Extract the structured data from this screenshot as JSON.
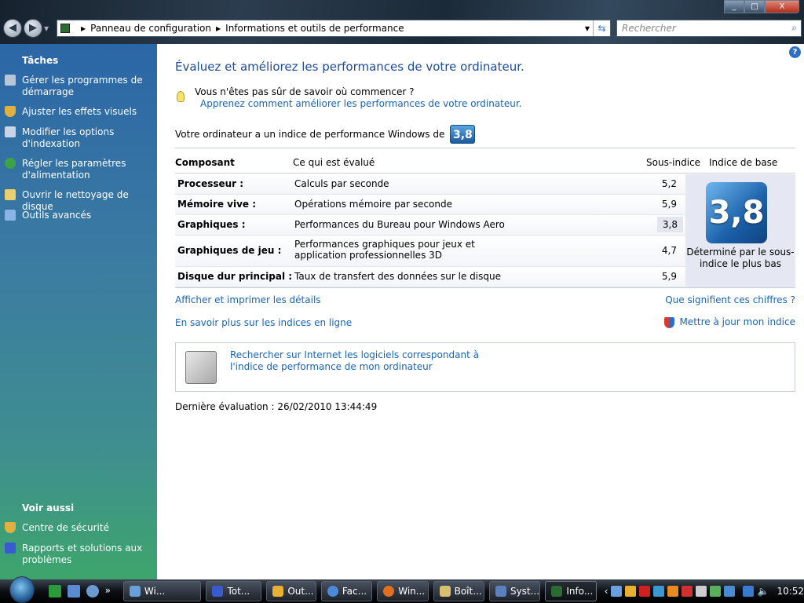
{
  "window": {
    "minimize": "_",
    "maximize": "□",
    "close": "X"
  },
  "nav": {
    "back": "◀",
    "forward": "▶"
  },
  "address": {
    "crumbs": [
      "Panneau de configuration",
      "Informations et outils de performance"
    ]
  },
  "search": {
    "placeholder": "Rechercher"
  },
  "sidebar": {
    "tasks_title": "Tâches",
    "tasks": [
      {
        "label": "Gérer les programmes de démarrage",
        "icon": "startup-programs-icon",
        "color": "#b9c6d8"
      },
      {
        "label": "Ajuster les effets visuels",
        "icon": "shield-icon",
        "color": "#e0b040"
      },
      {
        "label": "Modifier les options d'indexation",
        "icon": "indexing-icon",
        "color": "#c9d4e4"
      },
      {
        "label": "Régler les paramètres d'alimentation",
        "icon": "power-icon",
        "color": "#3aa34a"
      },
      {
        "label": "Ouvrir le nettoyage de disque",
        "icon": "disk-cleanup-icon",
        "color": "#e8d070"
      },
      {
        "label": "Outils avancés",
        "icon": "advanced-tools-icon",
        "color": "#8ab4e8"
      }
    ],
    "see_also_title": "Voir aussi",
    "see_also": [
      {
        "label": "Centre de sécurité",
        "icon": "security-center-icon",
        "color": "#e0b040"
      },
      {
        "label": "Rapports et solutions aux problèmes",
        "icon": "problem-reports-icon",
        "color": "#3a5ad0"
      }
    ]
  },
  "main": {
    "title": "Évaluez et améliorez les performances de votre ordinateur.",
    "hint_question": "Vous n'êtes pas sûr de savoir où commencer ?",
    "hint_link": "Apprenez comment améliorer les performances de votre ordinateur.",
    "index_text": "Votre ordinateur a un indice de performance Windows de",
    "base_score": "3,8",
    "table": {
      "headers": [
        "Composant",
        "Ce qui est évalué",
        "Sous-indice",
        "Indice de base"
      ],
      "rows": [
        {
          "component": "Processeur :",
          "evaluated": "Calculs par seconde",
          "score": "5,2"
        },
        {
          "component": "Mémoire vive :",
          "evaluated": "Opérations mémoire par seconde",
          "score": "5,9"
        },
        {
          "component": "Graphiques :",
          "evaluated": "Performances du Bureau pour Windows Aero",
          "score": "3,8"
        },
        {
          "component": "Graphiques de jeu :",
          "evaluated": "Performances graphiques pour jeux et application professionnelles 3D",
          "score": "4,7"
        },
        {
          "component": "Disque dur principal :",
          "evaluated": "Taux de transfert des données sur le disque",
          "score": "5,9"
        }
      ],
      "base_caption": "Déterminé par le sous-indice le plus bas"
    },
    "links": {
      "details": "Afficher et imprimer les détails",
      "meaning": "Que signifient ces chiffres ?",
      "learn_more": "En savoir plus sur les indices en ligne",
      "update": "Mettre à jour mon indice"
    },
    "software_link": "Rechercher sur Internet les logiciels correspondant à l'indice de performance de mon ordinateur",
    "last_eval": "Dernière évaluation : 26/02/2010 13:44:49"
  },
  "taskbar": {
    "buttons": [
      {
        "label": "Wi...",
        "color": "#6aa0d8"
      },
      {
        "label": "Tot...",
        "color": "#3a5ad0"
      },
      {
        "label": "Out...",
        "color": "#e8b030"
      },
      {
        "label": "Fac...",
        "color": "#4a8ad8"
      },
      {
        "label": "Win...",
        "color": "#e07020"
      },
      {
        "label": "Boît...",
        "color": "#d8c070"
      },
      {
        "label": "Syst...",
        "color": "#5a80c0"
      },
      {
        "label": "Info...",
        "color": "#2b6a32"
      }
    ],
    "clock": "10:52"
  }
}
